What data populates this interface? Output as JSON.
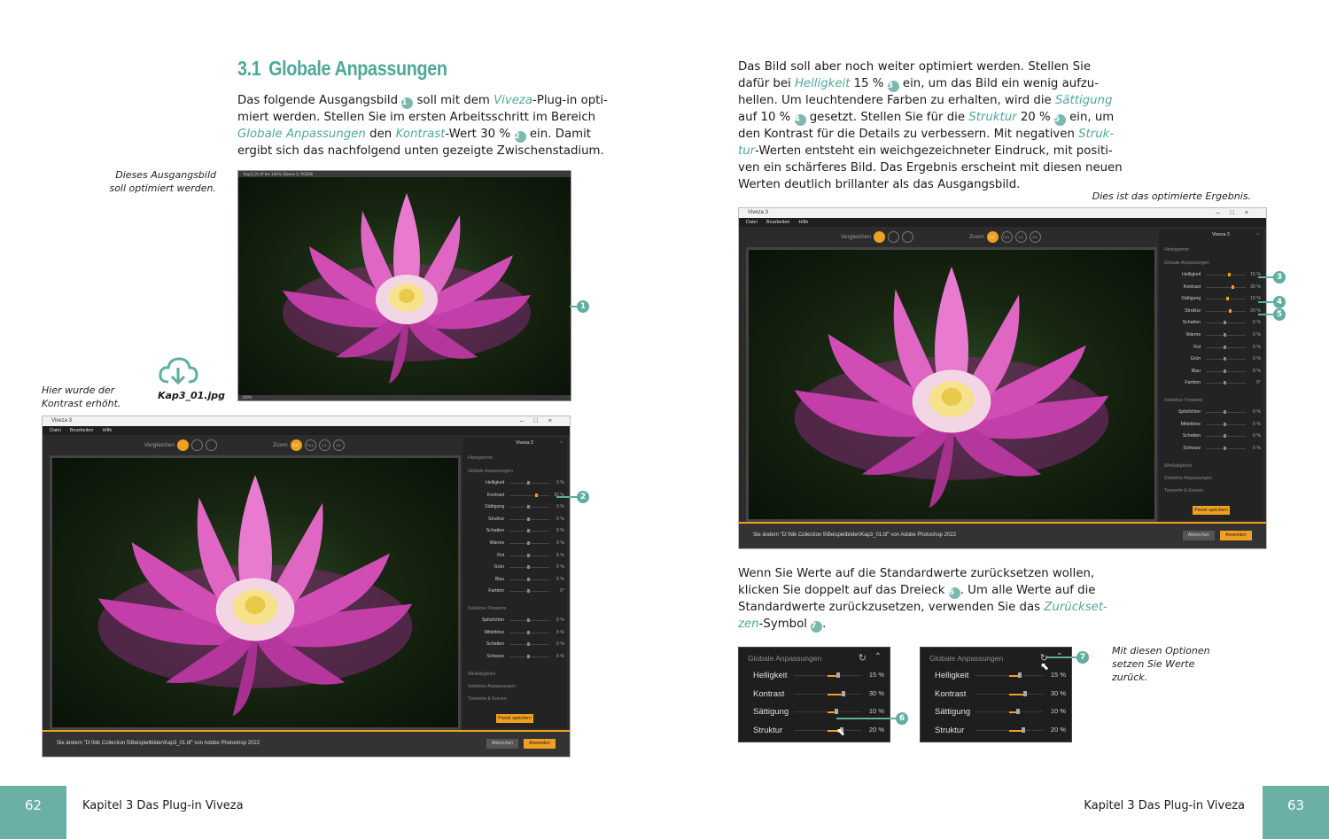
{
  "left_page": {
    "section_number": "3.1",
    "section_title": "Globale Anpassungen",
    "para1": [
      [
        "Das folgende Ausgangsbild ",
        {
          "b": "1"
        },
        " soll mit dem ",
        {
          "hl": "Viveza"
        },
        "-Plug-in opti-"
      ],
      [
        "miert werden. Stellen Sie im ersten Arbeitsschritt im Bereich"
      ],
      [
        {
          "hl": "Globale Anpassungen"
        },
        " den ",
        {
          "hl": "Kontrast"
        },
        "-Wert 30 % ",
        {
          "b": "2"
        },
        " ein. Damit"
      ],
      [
        "ergibt sich das nachfolgend unten gezeigte Zwischenstadium."
      ]
    ],
    "caption_original": [
      "Dieses Ausgangsbild",
      "soll optimiert werden."
    ],
    "download_file": "Kap3_01.jpg",
    "caption_contrast": [
      "Hier wurde der",
      "Kontrast erhöht."
    ],
    "photo_titlebar": "Kap3_01.tif bei 100% (Ebene 0, RGB/8)",
    "photo_statusbar": "100%"
  },
  "right_page": {
    "para2": [
      [
        "Das Bild soll aber noch weiter optimiert werden. Stellen Sie"
      ],
      [
        "dafür bei ",
        {
          "hl": "Helligkeit"
        },
        " 15 % ",
        {
          "b": "3"
        },
        " ein, um das Bild ein wenig aufzu-"
      ],
      [
        "hellen. Um leuchtendere Farben zu erhalten, wird die ",
        {
          "hl": "Sättigung"
        }
      ],
      [
        "auf 10 % ",
        {
          "b": "4"
        },
        " gesetzt. Stellen Sie für die ",
        {
          "hl": "Struktur"
        },
        " 20 % ",
        {
          "b": "5"
        },
        " ein, um"
      ],
      [
        "den Kontrast für die Details zu verbessern. Mit negativen ",
        {
          "hl": "Struk-"
        }
      ],
      [
        {
          "hl": "tur"
        },
        "-Werten entsteht ein weichgezeichneter Eindruck, mit positi-"
      ],
      [
        "ven ein schärferes Bild. Das Ergebnis erscheint mit diesen neuen"
      ],
      [
        "Werten deutlich brillanter als das Ausgangsbild."
      ]
    ],
    "caption_result": "Dies ist das optimierte Ergebnis.",
    "para3": [
      [
        "Wenn Sie Werte auf die Standardwerte zurücksetzen wollen,"
      ],
      [
        "klicken Sie doppelt auf das Dreieck ",
        {
          "b": "6"
        },
        ". Um alle Werte auf die"
      ],
      [
        "Standardwerte zurückzusetzen, verwenden Sie das ",
        {
          "hl": "Zurückset-"
        }
      ],
      [
        {
          "hl": "zen"
        },
        "-Symbol ",
        {
          "b": "7"
        },
        "."
      ]
    ],
    "caption_options": [
      "Mit diesen Optionen",
      "setzen Sie Werte",
      "zurück."
    ]
  },
  "viveza": {
    "window_title": "Viveza 3",
    "menu": [
      "Datei",
      "Bearbeiten",
      "Hilfe"
    ],
    "compare_label": "Vergleichen",
    "zoom_label": "Zoom",
    "zoom_options": [
      "FIT",
      "FILL",
      "1:1",
      "2:1"
    ],
    "panel_title": "Viveza 3",
    "histogram_label": "Histogramm",
    "global_label": "Globale Anpassungen",
    "selective_label": "Selektive Tonwerte",
    "whitebalance_label": "Weißabgleich",
    "selective_adj_label": "Selektive Anpassungen",
    "curves_label": "Tonwerte & Kurven",
    "preset_button": "Preset speichern",
    "cancel_button": "Abbrechen",
    "apply_button": "Anwenden",
    "status_text": "Sie ändern \"D:\\Nik Collection 5\\Beispielbilder\\Kap3_01.tif\" von Adobe Photoshop 2022",
    "global_sliders": [
      "Helligkeit",
      "Kontrast",
      "Sättigung",
      "Struktur",
      "Schatten",
      "Wärme",
      "Rot",
      "Grün",
      "Blau",
      "Farbton"
    ],
    "selective_sliders": [
      "Spitzlichter",
      "Mitteltöne",
      "Schatten",
      "Schwarz"
    ],
    "values_contrast_window": [
      "0 %",
      "30 %",
      "0 %",
      "0 %",
      "0 %",
      "0 %",
      "0 %",
      "0 %",
      "0 %",
      "0°"
    ],
    "values_result_window": [
      "15 %",
      "30 %",
      "10 %",
      "20 %",
      "0 %",
      "0 %",
      "0 %",
      "0 %",
      "0 %",
      "0°"
    ],
    "selective_values": [
      "0 %",
      "0 %",
      "0 %",
      "0 %"
    ]
  },
  "crop_panels": {
    "header": "Globale Anpassungen",
    "sliders": [
      {
        "label": "Helligkeit",
        "value": "15 %"
      },
      {
        "label": "Kontrast",
        "value": "30 %"
      },
      {
        "label": "Sättigung",
        "value": "10 %"
      },
      {
        "label": "Struktur",
        "value": "20 %"
      }
    ]
  },
  "callouts": [
    "1",
    "2",
    "3",
    "4",
    "5",
    "6",
    "7"
  ],
  "footer": {
    "left_page_number": "62",
    "right_page_number": "63",
    "chapter_left": "Kapitel 3   Das Plug-in Viveza",
    "chapter_right": "Kapitel 3   Das Plug-in Viveza"
  },
  "colors": {
    "accent": "#4fa89a",
    "page_tab": "#6bb0a4",
    "viveza_orange": "#f0a020"
  }
}
